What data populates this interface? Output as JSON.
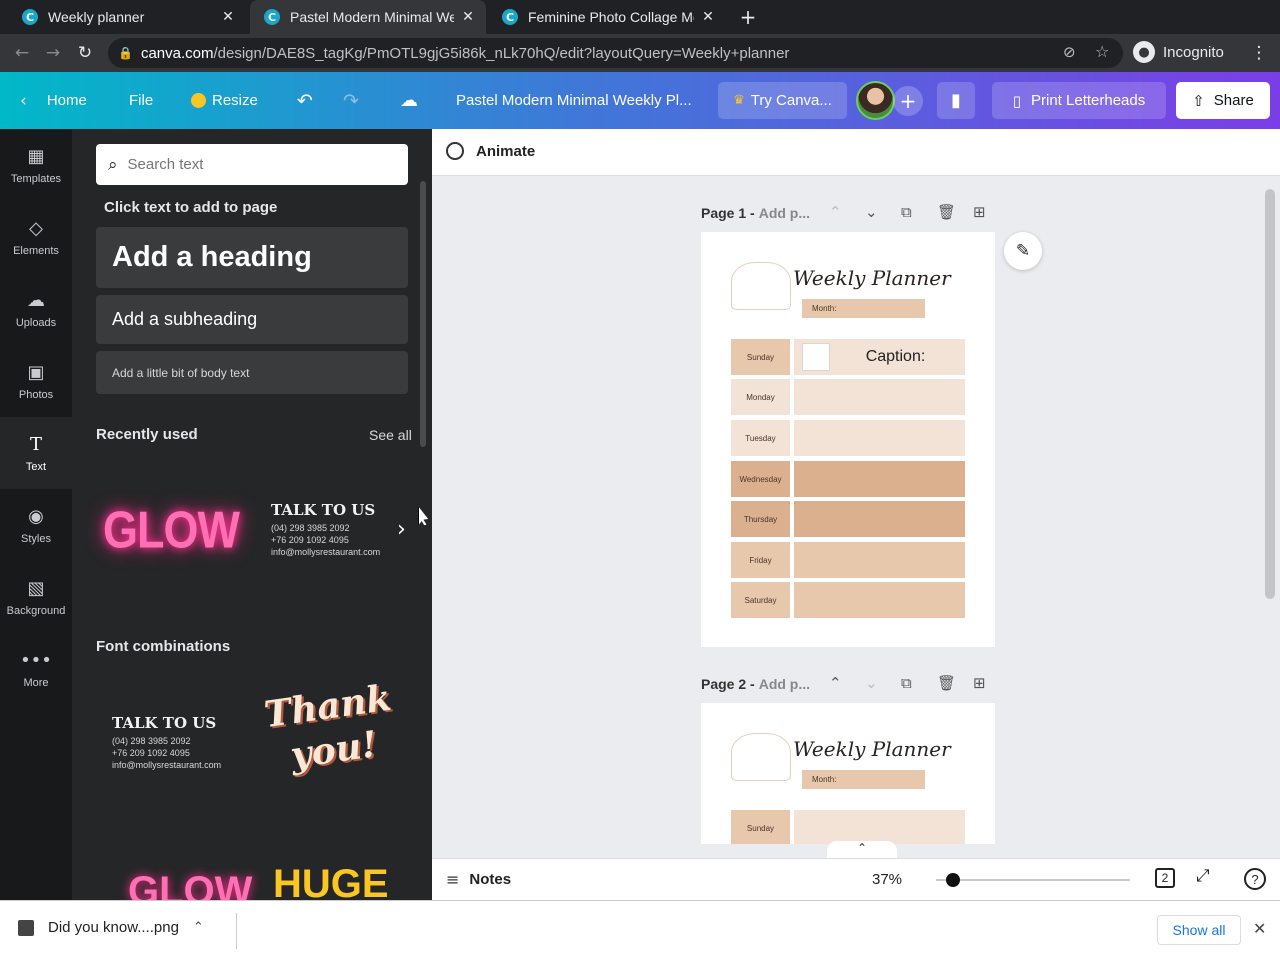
{
  "browser": {
    "tabs": [
      {
        "title": "Weekly planner",
        "active": false
      },
      {
        "title": "Pastel Modern Minimal We",
        "active": true
      },
      {
        "title": "Feminine Photo Collage Mo",
        "active": false
      }
    ],
    "url_domain": "canva.com",
    "url_path": "/design/DAE8S_tagKg/PmOTL9gjG5i86k_nLk70hQ/edit?layoutQuery=Weekly+planner",
    "profile_label": "Incognito"
  },
  "topbar": {
    "home": "Home",
    "file": "File",
    "resize": "Resize",
    "doc_title": "Pastel Modern Minimal Weekly Pl...",
    "try_canva": "Try Canva...",
    "print": "Print Letterheads",
    "share": "Share"
  },
  "rail": [
    {
      "label": "Templates",
      "icon": "templates-icon"
    },
    {
      "label": "Elements",
      "icon": "elements-icon"
    },
    {
      "label": "Uploads",
      "icon": "uploads-icon"
    },
    {
      "label": "Photos",
      "icon": "photos-icon"
    },
    {
      "label": "Text",
      "icon": "text-icon",
      "active": true
    },
    {
      "label": "Styles",
      "icon": "styles-icon"
    },
    {
      "label": "Background",
      "icon": "background-icon"
    },
    {
      "label": "More",
      "icon": "more-icon"
    }
  ],
  "panel": {
    "search_placeholder": "Search text",
    "click_text": "Click text to add to page",
    "heading": "Add a heading",
    "subheading": "Add a subheading",
    "body": "Add a little bit of body text",
    "recently_used": "Recently used",
    "see_all": "See all",
    "font_combinations": "Font combinations",
    "glow": "GLOW",
    "talk_to_us": "TALK TO US",
    "contact_lines": [
      "(04) 298 3985 2092",
      "+76 209 1092 4095",
      "info@mollysrestaurant.com"
    ],
    "thank": "Thank",
    "you": "you!",
    "huge": "HUGE"
  },
  "canvas": {
    "animate": "Animate",
    "page1_label": "Page 1 -",
    "page1_add": "Add p...",
    "page2_label": "Page 2 -",
    "page2_add": "Add p...",
    "planner_title": "Weekly Planner",
    "month": "Month:",
    "caption": "Caption:",
    "days": [
      "Sunday",
      "Monday",
      "Tuesday",
      "Wednesday",
      "Thursday",
      "Friday",
      "Saturday"
    ],
    "notes": "Notes",
    "zoom": "37%",
    "zoom_fraction": 0.37,
    "page_count": "2"
  },
  "download": {
    "file": "Did you know....png",
    "show_all": "Show all"
  },
  "colors": {
    "light_peach": "#f3e2d6",
    "mid_peach": "#e8c8ad",
    "dark_peach": "#dbb08e",
    "accent_purple": "#8b3dff"
  }
}
